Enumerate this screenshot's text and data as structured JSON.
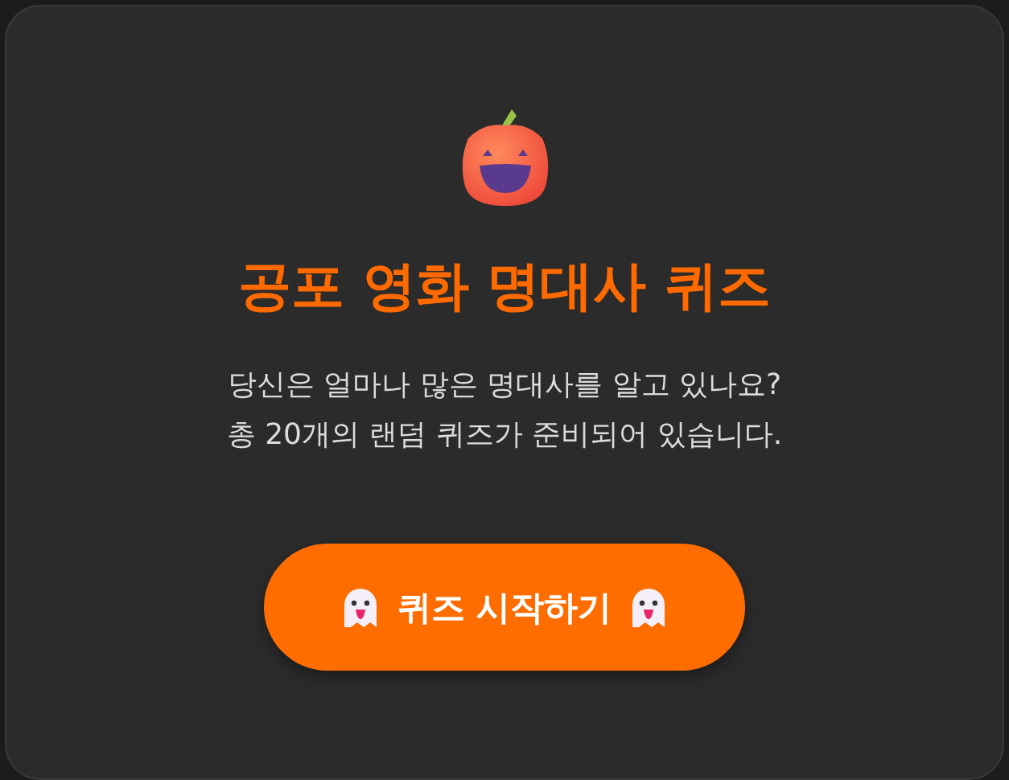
{
  "title": "공포 영화 명대사 퀴즈",
  "description_lines": [
    "당신은 얼마나 많은 명대사를 알고 있나요?",
    "총 20개의 랜덤 퀴즈가 준비되어 있습니다."
  ],
  "start_button": {
    "label": "퀴즈 시작하기"
  }
}
